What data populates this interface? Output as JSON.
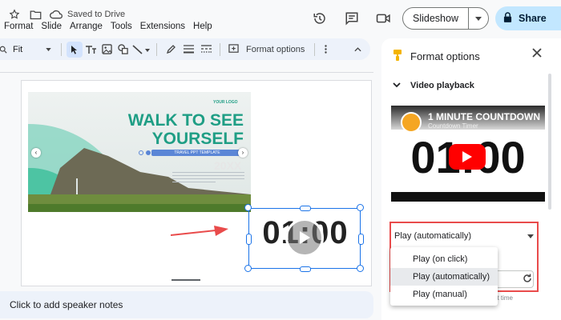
{
  "header": {
    "saved_status": "Saved to Drive",
    "menus": [
      "Format",
      "Slide",
      "Arrange",
      "Tools",
      "Extensions",
      "Help"
    ],
    "slideshow_label": "Slideshow",
    "share_label": "Share"
  },
  "toolbar": {
    "zoom_value": "Fit",
    "format_options_label": "Format options"
  },
  "slide": {
    "logo": "YOUR LOGO",
    "title": "WALK TO SEE YOURSELF",
    "band": "TRAVEL PPT TEMPLATE",
    "year": "20XX",
    "video_text": "01:00"
  },
  "notes": {
    "placeholder": "Click to add speaker notes"
  },
  "panel": {
    "title": "Format options",
    "section": "Video playback",
    "video_title": "1 MINUTE COUNTDOWN",
    "video_channel": "Countdown Timer",
    "video_number": "01:00",
    "play_mode": "Play (automatically)",
    "hint": "nt time"
  },
  "dropdown": {
    "options": [
      "Play (on click)",
      "Play (automatically)",
      "Play (manual)"
    ],
    "selected": "Play (automatically)"
  },
  "colors": {
    "accent": "#1a73e8",
    "share": "#c2e7ff",
    "highlight_box": "#e94b4b",
    "youtube": "#ff0000"
  }
}
